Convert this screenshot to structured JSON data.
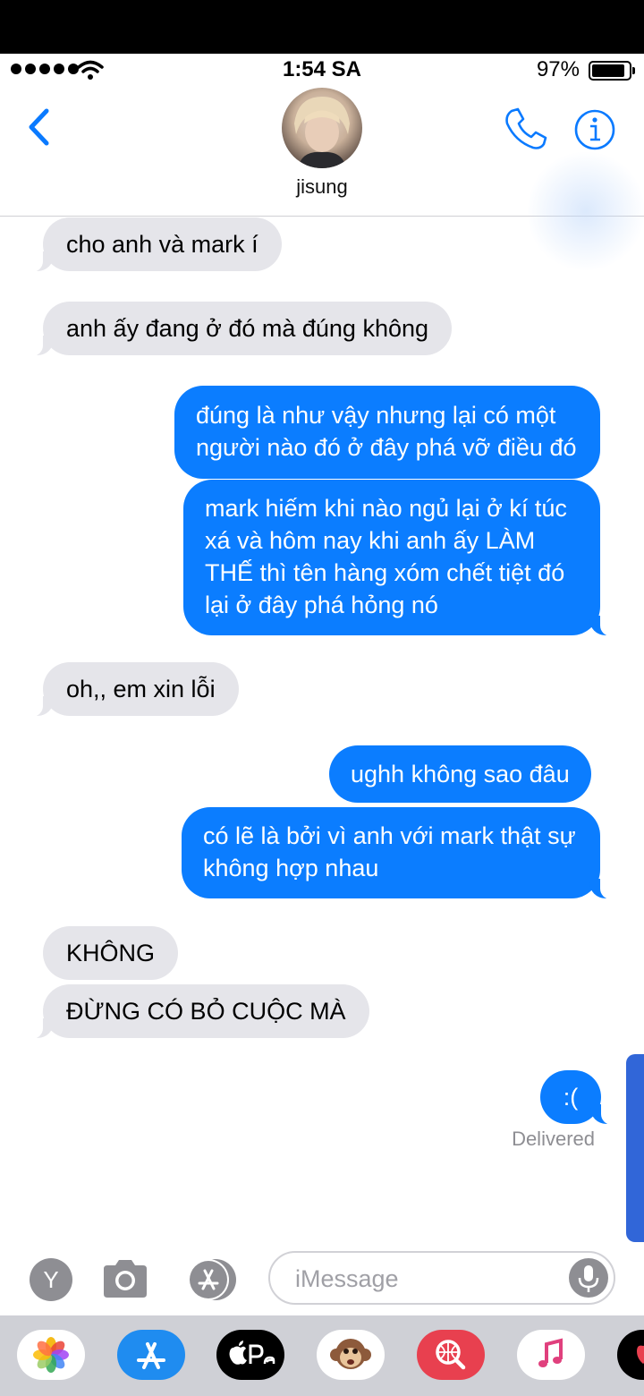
{
  "status_bar": {
    "time": "1:54 SA",
    "battery": "97%"
  },
  "header": {
    "contact_name": "jisung"
  },
  "messages": [
    {
      "dir": "in",
      "text": "cho anh và mark í"
    },
    {
      "dir": "in",
      "text": "anh ấy đang ở đó mà đúng không"
    },
    {
      "dir": "out",
      "lines": [
        "đúng là như vậy nhưng lại có một",
        "người nào đó ở đây phá vỡ điều đó"
      ]
    },
    {
      "dir": "out",
      "lines": [
        "mark hiếm khi nào ngủ lại ở kí túc",
        "xá và hôm nay khi anh ấy LÀM",
        "THẾ thì tên hàng xóm chết tiệt đó",
        "lại ở đây phá hỏng nó"
      ]
    },
    {
      "dir": "in",
      "text": "oh,, em xin lỗi"
    },
    {
      "dir": "out",
      "text": "ughh không sao đâu"
    },
    {
      "dir": "out",
      "lines": [
        "có lẽ là bởi vì anh với mark thật sự",
        "không hợp nhau"
      ]
    },
    {
      "dir": "in",
      "text": "KHÔNG"
    },
    {
      "dir": "in",
      "text": "ĐỪNG CÓ BỎ CUỘC MÀ"
    },
    {
      "dir": "out",
      "text": ":("
    }
  ],
  "delivered_label": "Delivered",
  "input": {
    "placeholder": "iMessage",
    "y_button": "Y"
  },
  "dock": [
    "photos-app",
    "app-store-app",
    "apple-pay-app",
    "animoji-app",
    "web-search-app",
    "music-app",
    "heart-app"
  ],
  "colors": {
    "outgoing": "#0b7dff",
    "incoming": "#e5e5ea",
    "accent": "#0a7aff",
    "dock_bg": "#cfd0d6"
  }
}
